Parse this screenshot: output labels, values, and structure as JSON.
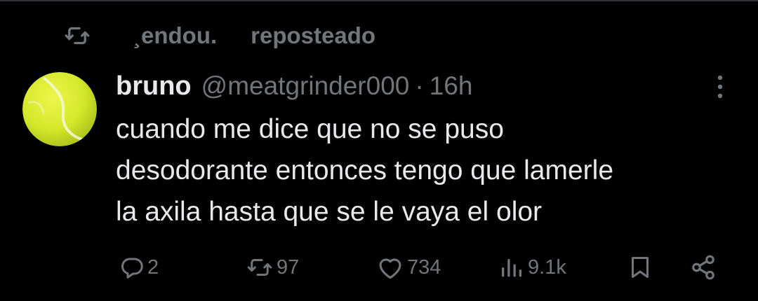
{
  "repost_context": {
    "icon": "repost-icon",
    "user": "¸endou.",
    "action": "reposteado"
  },
  "tweet": {
    "avatar": "tennis-ball-avatar",
    "display_name": "bruno",
    "handle": "@meatgrinder000",
    "separator": "·",
    "time": "16h",
    "text": "cuando me dice que no se puso\ndesodorante entonces tengo que lamerle\nla axila hasta que se le vaya el olor"
  },
  "actions": {
    "replies": "2",
    "reposts": "97",
    "likes": "734",
    "views": "9.1k"
  },
  "colors": {
    "background": "#000000",
    "text": "#e7e9ea",
    "muted": "#71767b",
    "avatar": "#d7ec2a"
  }
}
